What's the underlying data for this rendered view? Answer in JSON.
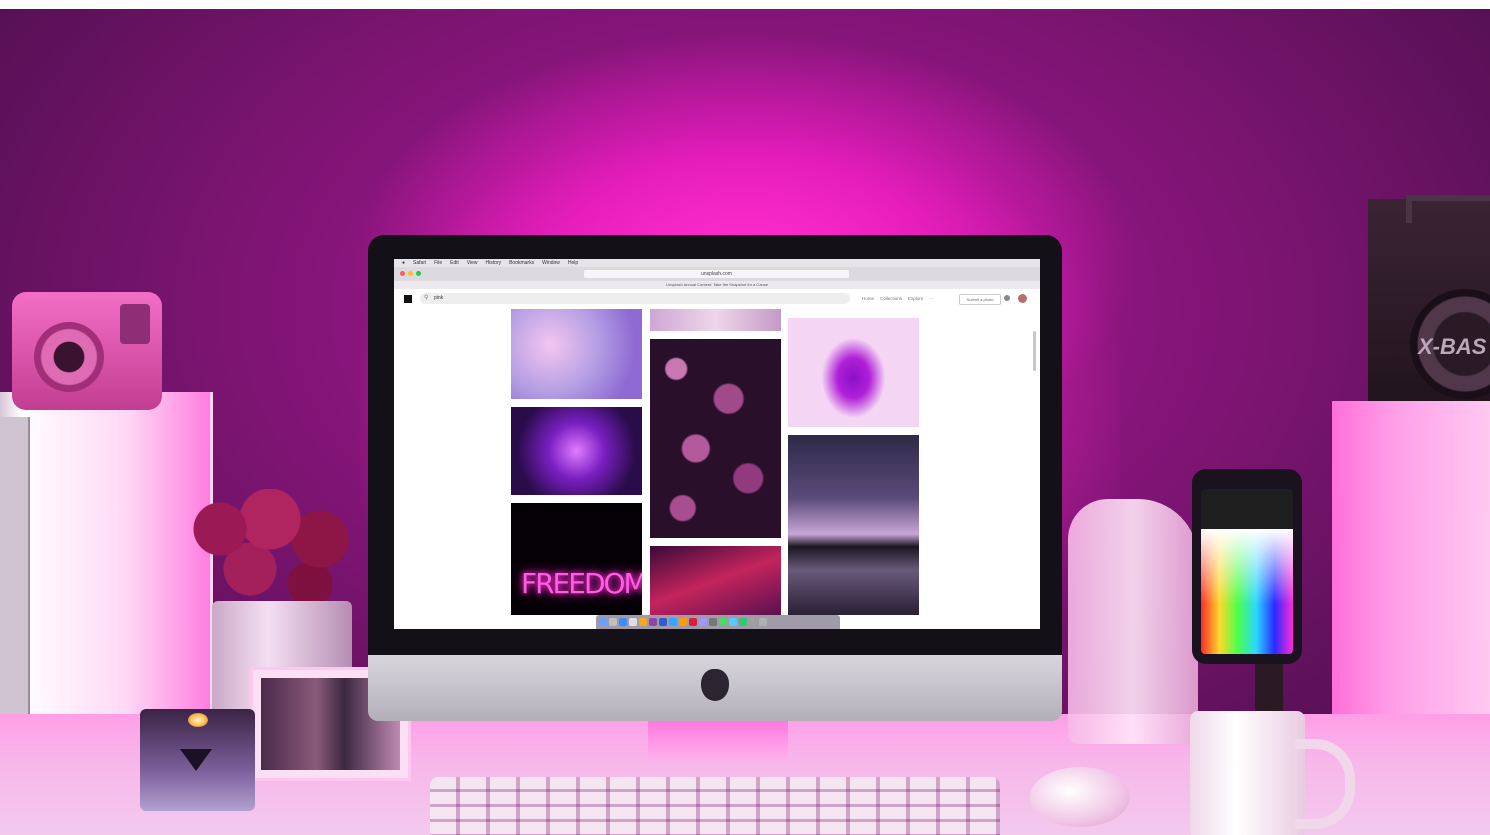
{
  "menubar": {
    "items": [
      "Safari",
      "File",
      "Edit",
      "View",
      "History",
      "Bookmarks",
      "Window",
      "Help"
    ]
  },
  "browser": {
    "url": "unsplash.com",
    "banner": "Unsplash Annual Contest: Take the Snapshot for a Cause"
  },
  "site": {
    "search_value": "pink",
    "nav": [
      "Home",
      "Collections",
      "Explore"
    ],
    "submit_label": "Submit a photo"
  },
  "photos": [
    {
      "name": "pink-smoke",
      "colors": [
        "#b39ae3",
        "#f0b8e8",
        "#9a7fd6"
      ]
    },
    {
      "name": "purple-lights",
      "colors": [
        "#2a0c4a",
        "#8a2cd8",
        "#4a1a7a"
      ]
    },
    {
      "name": "freedom-neon",
      "colors": [
        "#050005",
        "#1a0020",
        "#000000"
      ]
    },
    {
      "name": "purple-clouds",
      "colors": [
        "#d8b2d8",
        "#e6cde3",
        "#c59ac6"
      ]
    },
    {
      "name": "fittonia-leaves",
      "colors": [
        "#2a0f2a",
        "#a04a8a",
        "#1c0a1c"
      ]
    },
    {
      "name": "red-sky",
      "colors": [
        "#3a0a3a",
        "#c4245c",
        "#5a1050"
      ]
    },
    {
      "name": "purple-ink-cloud",
      "colors": [
        "#f4d6f4",
        "#b020d8",
        "#f7dcf6"
      ]
    },
    {
      "name": "milky-way-lake",
      "colors": [
        "#3a3455",
        "#c8a6d6",
        "#2a2035"
      ]
    }
  ],
  "freedom_text": "FREEDOM",
  "radio_brand": "X-BAS",
  "colors": {
    "wall": "#c41aa8",
    "glow": "#ff2fcf",
    "desk": "#f7b7ea"
  }
}
